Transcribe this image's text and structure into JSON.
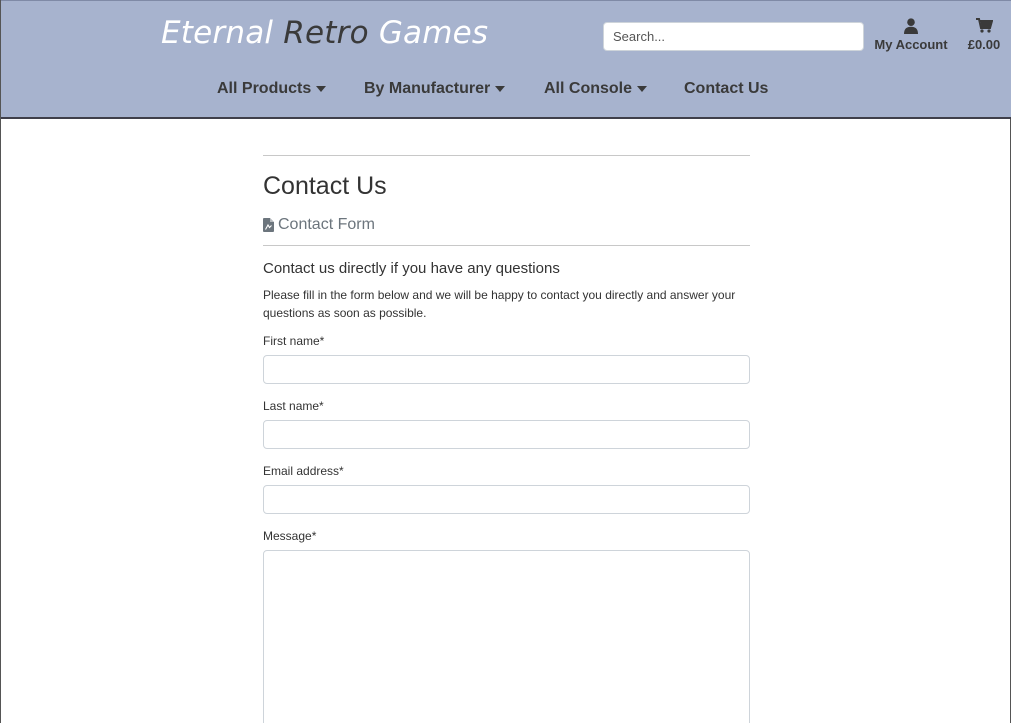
{
  "brand": {
    "word1": "Eternal",
    "word2": "Retro",
    "word3": "Games"
  },
  "search": {
    "placeholder": "Search..."
  },
  "account": {
    "label": "My Account",
    "icon": "user-icon"
  },
  "cart": {
    "total": "£0.00",
    "icon": "cart-icon"
  },
  "nav": {
    "items": [
      {
        "label": "All Products",
        "dropdown": true
      },
      {
        "label": "By Manufacturer",
        "dropdown": true
      },
      {
        "label": "All Console",
        "dropdown": true
      },
      {
        "label": "Contact Us",
        "dropdown": false
      }
    ]
  },
  "page": {
    "title": "Contact Us",
    "form_heading": "Contact Form",
    "form_heading_icon": "file-icon",
    "subheading": "Contact us directly if you have any questions",
    "intro": "Please fill in the form below and we will be happy to contact you directly and answer your questions as soon as possible."
  },
  "form": {
    "first_name_label": "First name*",
    "last_name_label": "Last name*",
    "email_label": "Email address*",
    "message_label": "Message*"
  },
  "colors": {
    "header_bg": "#a7b3ce",
    "text_dark": "#3a3a3a",
    "muted": "#6c757d"
  }
}
